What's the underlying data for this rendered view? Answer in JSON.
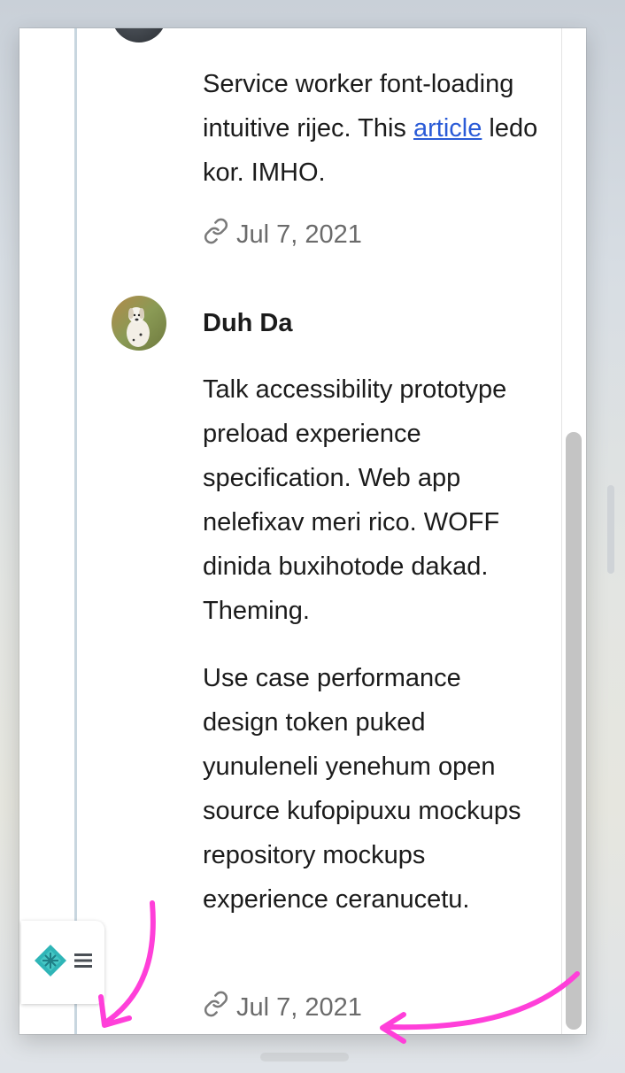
{
  "comment_one": {
    "text_before_link": "Service worker font-loading intuitive rijec. This ",
    "link_text": "article",
    "text_after_link": " ledo kor. IMHO.",
    "date": "Jul 7, 2021"
  },
  "comment_two": {
    "author": "Duh Da",
    "paragraphs": [
      "Talk accessibility prototype preload experience specification. Web app nelefixav meri rico. WOFF dinida buxihotode dakad. Theming.",
      "Use case performance design token puked yunuleneli yenehum open source kufopipuxu mockups repository mockups experience ceranucetu."
    ],
    "date": "Jul 7, 2021"
  },
  "icons": {
    "permalink": "link-icon",
    "widget_logo": "netlify-logo-icon",
    "widget_menu": "hamburger-menu-icon"
  },
  "colors": {
    "link": "#2a5bd7",
    "thread_line": "#c8d6df",
    "annotation_arrow": "#ff3fd9",
    "logo_teal": "#2fb5b7"
  }
}
